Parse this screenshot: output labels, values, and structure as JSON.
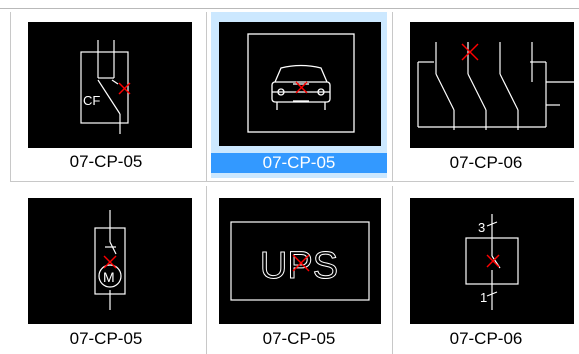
{
  "thumbnails": [
    {
      "label": "07-CP-05",
      "symbol": "circuit-breaker-cf-icon",
      "symbol_text": "CF",
      "selected": false
    },
    {
      "label": "07-CP-05",
      "symbol": "vehicle-charger-icon",
      "symbol_text": "",
      "selected": true
    },
    {
      "label": "07-CP-06",
      "symbol": "three-pole-switch-icon",
      "symbol_text": "",
      "selected": false
    },
    {
      "label": "07-CP-05",
      "symbol": "motor-switch-icon",
      "symbol_text": "M",
      "selected": false
    },
    {
      "label": "07-CP-05",
      "symbol": "ups-box-icon",
      "symbol_text": "UPS",
      "selected": false
    },
    {
      "label": "07-CP-06",
      "symbol": "switch-3-1-icon",
      "symbol_text_top": "3",
      "symbol_text_bottom": "1",
      "selected": false
    }
  ],
  "colors": {
    "thumb_bg": "#000000",
    "stroke": "#ffffff",
    "marker": "#ff0000",
    "selected_caption_bg": "#3399ff",
    "selected_tile_bg": "#cce8ff"
  }
}
